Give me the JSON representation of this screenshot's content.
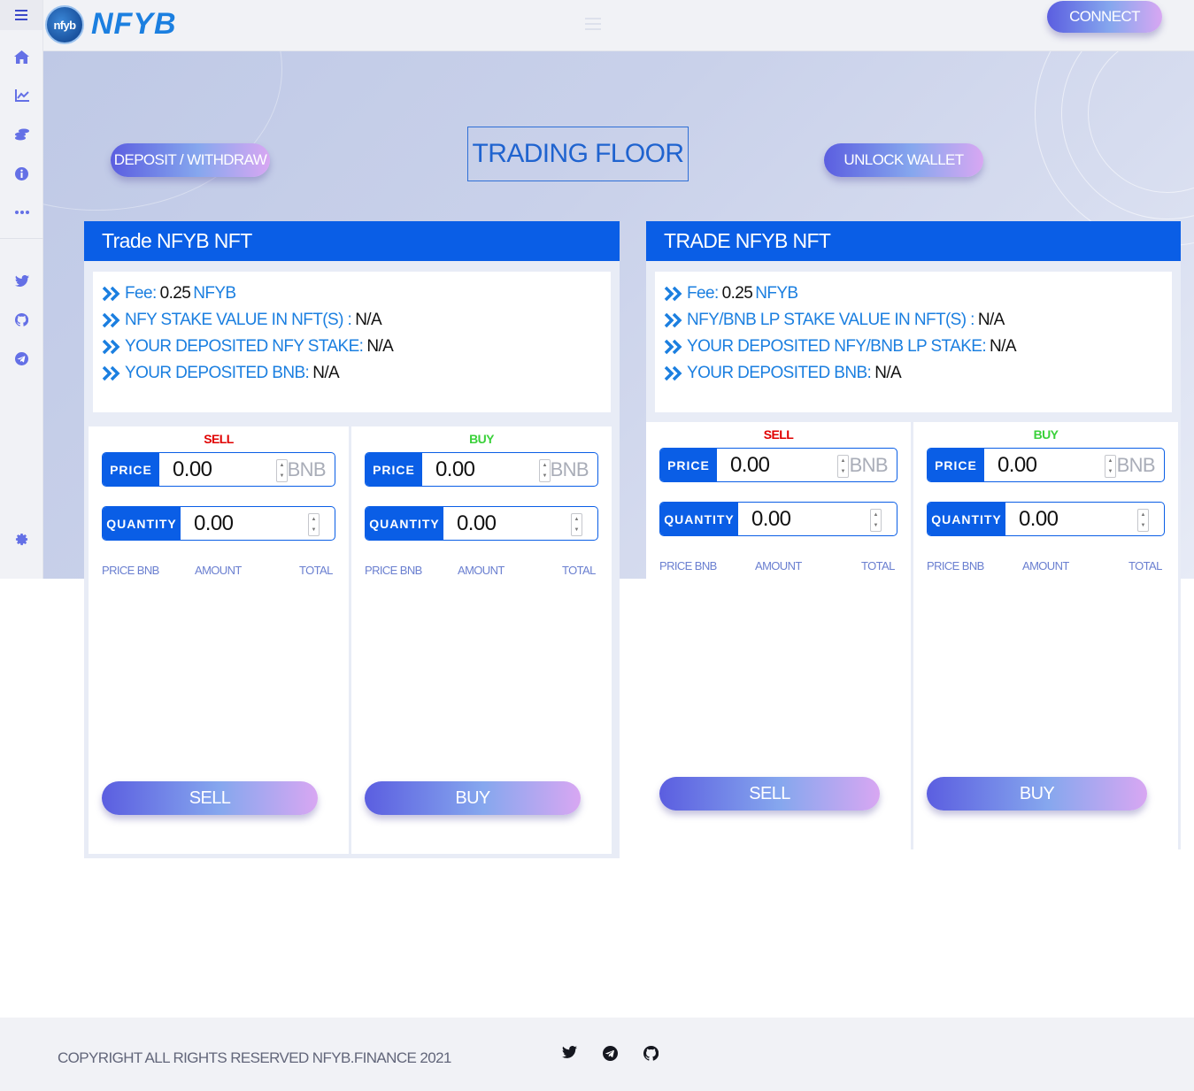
{
  "brand": {
    "logo_mark": "nfyb",
    "logo_text": "NFYB"
  },
  "header": {
    "connect_label": "CONNECT"
  },
  "sidebar": {
    "icons": [
      "menu-icon",
      "home-icon",
      "chart-line-icon",
      "coins-icon",
      "info-icon",
      "more-icon",
      "twitter-icon",
      "github-icon",
      "telegram-icon",
      "settings-icon"
    ]
  },
  "hero": {
    "deposit_label": "DEPOSIT / WITHDRAW",
    "title": "TRADING FLOOR",
    "unlock_label": "UNLOCK WALLET"
  },
  "panels": [
    {
      "title": "Trade NFYB NFT",
      "info": [
        {
          "label": "Fee:",
          "value": "0.25",
          "suffix": "NFYB"
        },
        {
          "label": "NFY STAKE VALUE IN NFT(S) :",
          "value": "N/A"
        },
        {
          "label": "YOUR DEPOSITED NFY STAKE:",
          "value": "N/A"
        },
        {
          "label": "YOUR DEPOSITED BNB:",
          "value": "N/A"
        }
      ],
      "sell": {
        "title": "SELL",
        "price_label": "PRICE",
        "price_value": "0.00",
        "unit": "BNB",
        "qty_label": "QUANTITY",
        "qty_value": "0.00",
        "columns": [
          "PRICE BNB",
          "AMOUNT",
          "TOTAL"
        ],
        "button": "SELL"
      },
      "buy": {
        "title": "BUY",
        "price_label": "PRICE",
        "price_value": "0.00",
        "unit": "BNB",
        "qty_label": "QUANTITY",
        "qty_value": "0.00",
        "columns": [
          "PRICE BNB",
          "AMOUNT",
          "TOTAL"
        ],
        "button": "BUY"
      }
    },
    {
      "title": "TRADE NFYB NFT",
      "info": [
        {
          "label": "Fee:",
          "value": "0.25",
          "suffix": "NFYB"
        },
        {
          "label": "NFY/BNB LP STAKE VALUE IN NFT(S) :",
          "value": "N/A"
        },
        {
          "label": "YOUR DEPOSITED NFY/BNB LP STAKE:",
          "value": "N/A"
        },
        {
          "label": "YOUR DEPOSITED BNB:",
          "value": "N/A"
        }
      ],
      "sell": {
        "title": "SELL",
        "price_label": "PRICE",
        "price_value": "0.00",
        "unit": "BNB",
        "qty_label": "QUANTITY",
        "qty_value": "0.00",
        "columns": [
          "PRICE BNB",
          "AMOUNT",
          "TOTAL"
        ],
        "button": "SELL"
      },
      "buy": {
        "title": "BUY",
        "price_label": "PRICE",
        "price_value": "0.00",
        "unit": "BNB",
        "qty_label": "QUANTITY",
        "qty_value": "0.00",
        "columns": [
          "PRICE BNB",
          "AMOUNT",
          "TOTAL"
        ],
        "button": "BUY"
      }
    }
  ],
  "footer": {
    "copyright": "COPYRIGHT ALL RIGHTS RESERVED NFYB.FINANCE 2021",
    "icons": [
      "twitter-icon",
      "telegram-icon",
      "github-icon"
    ]
  },
  "colors": {
    "primary": "#0a5ee6",
    "sell": "#e00000",
    "buy": "#3ad13a",
    "link": "#1b7fe0"
  }
}
